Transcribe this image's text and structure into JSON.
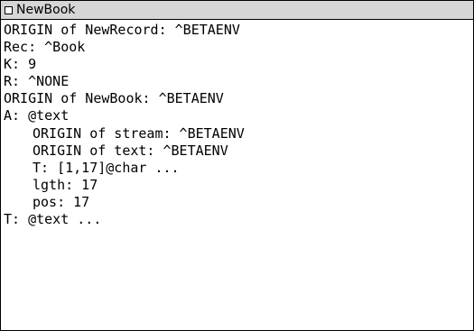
{
  "window": {
    "title": "NewBook"
  },
  "lines": [
    "ORIGIN of NewRecord: ^BETAENV",
    "Rec: ^Book",
    "K: 9",
    "R: ^NONE",
    "ORIGIN of NewBook: ^BETAENV",
    "A: @text",
    "ORIGIN of stream: ^BETAENV",
    "ORIGIN of text: ^BETAENV",
    "T: [1,17]@char ...",
    "lgth: 17",
    "pos: 17",
    "T: @text ..."
  ]
}
